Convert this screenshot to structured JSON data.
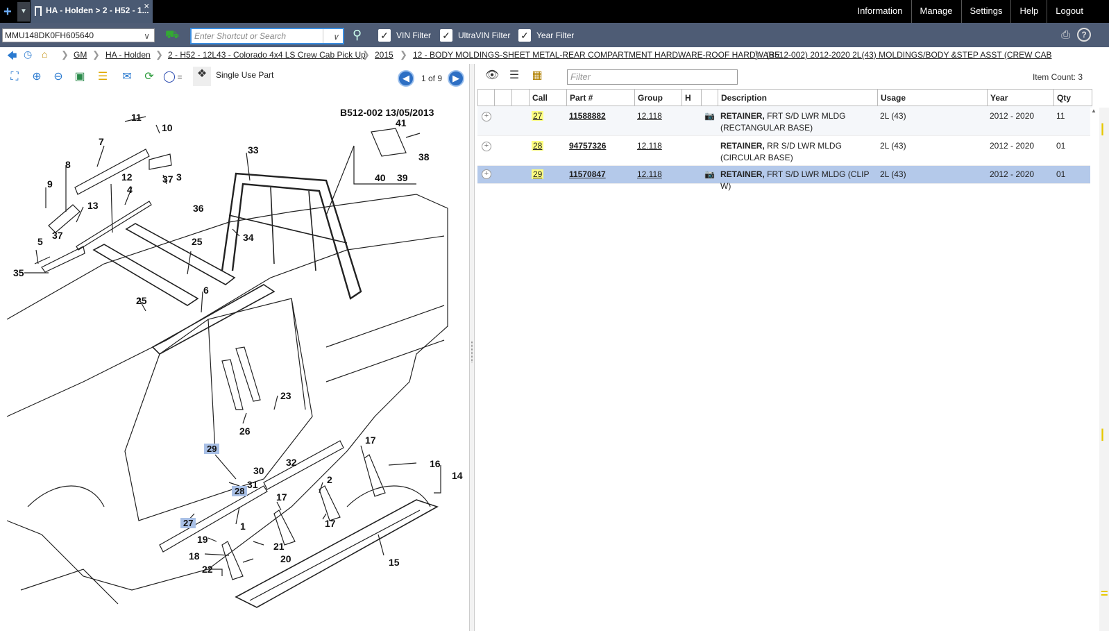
{
  "topbar": {
    "tab_label": "HA - Holden > 2 - H52 - 1...",
    "nav": [
      "Information",
      "Manage",
      "Settings",
      "Help",
      "Logout"
    ]
  },
  "filterbar": {
    "vin": "MMU148DK0FH605640",
    "search_placeholder": "Enter Shortcut or Search",
    "vin_filter": "VIN Filter",
    "ultravin_filter": "UltraVIN Filter",
    "year_filter": "Year Filter"
  },
  "breadcrumb": [
    "GM",
    "HA - Holden",
    "2 - H52 - 12L43 - Colorado 4x4 LS Crew Cab Pick Up",
    "2015",
    "12 - BODY MOLDINGS-SHEET METAL-REAR COMPARTMENT HARDWARE-ROOF HARDWARE",
    "(B512-002)  2012-2020  2L(43)  MOLDINGS/BODY &STEP ASST (CREW CAB"
  ],
  "diagram_toolbar": {
    "legend_label": "Single Use Part",
    "page_info": "1 of 9"
  },
  "diagram": {
    "ref": "B512-002  13/05/2013",
    "callouts": [
      "11",
      "10",
      "7",
      "8",
      "12",
      "37",
      "3",
      "9",
      "4",
      "13",
      "36",
      "5",
      "37",
      "35",
      "25",
      "25",
      "6",
      "33",
      "41",
      "38",
      "40",
      "39",
      "34",
      "29",
      "30",
      "31",
      "28",
      "27",
      "1",
      "2",
      "32",
      "17",
      "16",
      "14",
      "17",
      "17",
      "19",
      "21",
      "18",
      "20",
      "22",
      "15",
      "23",
      "26"
    ]
  },
  "parts_toolbar": {
    "filter_placeholder": "Filter",
    "item_count": "Item Count: 3"
  },
  "parts_table": {
    "headers": [
      "Call",
      "Part #",
      "Group",
      "H",
      "Description",
      "Usage",
      "Year",
      "Qty"
    ],
    "rows": [
      {
        "call": "27",
        "part": "11588882",
        "group": "12.118",
        "desc_bold": "RETAINER,",
        "desc": " FRT S/D LWR MLDG (RECTANGULAR BASE)",
        "usage": "2L (43)",
        "year": "2012 - 2020",
        "qty": "11"
      },
      {
        "call": "28",
        "part": "94757326",
        "group": "12.118",
        "desc_bold": "RETAINER,",
        "desc": " RR S/D LWR MLDG (CIRCULAR BASE)",
        "usage": "2L (43)",
        "year": "2012 - 2020",
        "qty": "01"
      },
      {
        "call": "29",
        "part": "11570847",
        "group": "12.118",
        "desc_bold": "RETAINER,",
        "desc": " FRT S/D LWR MLDG (CLIP W)",
        "usage": "2L (43)",
        "year": "2012 - 2020",
        "qty": "01"
      }
    ]
  }
}
